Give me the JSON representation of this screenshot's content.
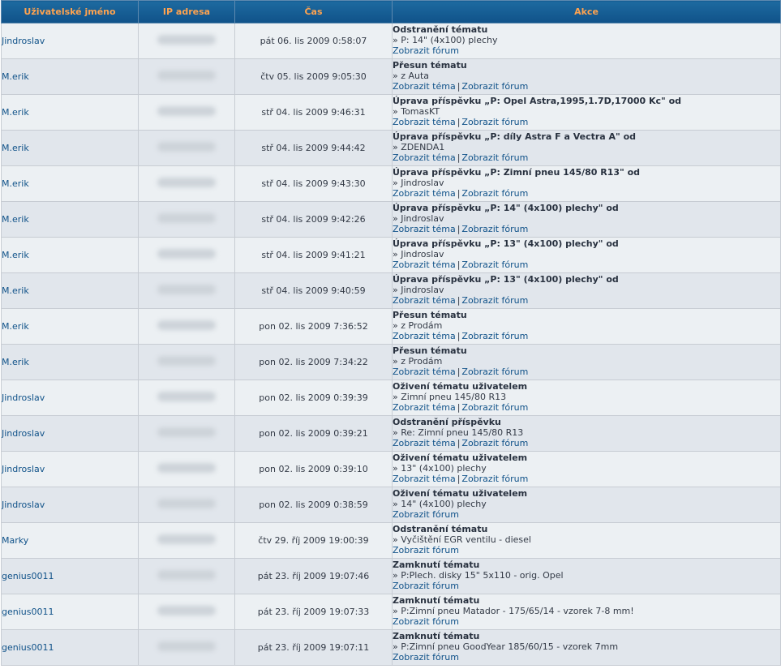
{
  "headers": {
    "user": "Uživatelské jméno",
    "ip": "IP adresa",
    "time": "Čas",
    "action": "Akce"
  },
  "links": {
    "topic": "Zobrazit téma",
    "forum": "Zobrazit fórum",
    "separator": "|"
  },
  "rows": [
    {
      "user": "Jindroslav",
      "time": "pát 06. lis 2009 0:58:07",
      "title": "Odstranění tématu",
      "detail": "» P: 14\" (4x100) plechy",
      "topic_link": false
    },
    {
      "user": "M.erik",
      "time": "čtv 05. lis 2009 9:05:30",
      "title": "Přesun tématu",
      "detail": "» z Auta",
      "topic_link": true
    },
    {
      "user": "M.erik",
      "time": "stř 04. lis 2009 9:46:31",
      "title": "Úprava příspěvku „P: Opel Astra,1995,1.7D,17000 Kc\" od",
      "detail": "» TomasKT",
      "topic_link": true
    },
    {
      "user": "M.erik",
      "time": "stř 04. lis 2009 9:44:42",
      "title": "Úprava příspěvku „P: díly Astra F a Vectra A\" od",
      "detail": "» ZDENDA1",
      "topic_link": true
    },
    {
      "user": "M.erik",
      "time": "stř 04. lis 2009 9:43:30",
      "title": "Úprava příspěvku „P: Zimní pneu 145/80 R13\" od",
      "detail": "» Jindroslav",
      "topic_link": true
    },
    {
      "user": "M.erik",
      "time": "stř 04. lis 2009 9:42:26",
      "title": "Úprava příspěvku „P: 14\" (4x100) plechy\" od",
      "detail": "» Jindroslav",
      "topic_link": true
    },
    {
      "user": "M.erik",
      "time": "stř 04. lis 2009 9:41:21",
      "title": "Úprava příspěvku „P: 13\" (4x100) plechy\" od",
      "detail": "» Jindroslav",
      "topic_link": true
    },
    {
      "user": "M.erik",
      "time": "stř 04. lis 2009 9:40:59",
      "title": "Úprava příspěvku „P: 13\" (4x100) plechy\" od",
      "detail": "» Jindroslav",
      "topic_link": true
    },
    {
      "user": "M.erik",
      "time": "pon 02. lis 2009 7:36:52",
      "title": "Přesun tématu",
      "detail": "» z Prodám",
      "topic_link": true
    },
    {
      "user": "M.erik",
      "time": "pon 02. lis 2009 7:34:22",
      "title": "Přesun tématu",
      "detail": "» z Prodám",
      "topic_link": true
    },
    {
      "user": "Jindroslav",
      "time": "pon 02. lis 2009 0:39:39",
      "title": "Oživení tématu uživatelem",
      "detail": "» Zimní pneu 145/80 R13",
      "topic_link": true
    },
    {
      "user": "Jindroslav",
      "time": "pon 02. lis 2009 0:39:21",
      "title": "Odstranění příspěvku",
      "detail": "» Re: Zimní pneu 145/80 R13",
      "topic_link": true
    },
    {
      "user": "Jindroslav",
      "time": "pon 02. lis 2009 0:39:10",
      "title": "Oživení tématu uživatelem",
      "detail": "» 13\" (4x100) plechy",
      "topic_link": true
    },
    {
      "user": "Jindroslav",
      "time": "pon 02. lis 2009 0:38:59",
      "title": "Oživení tématu uživatelem",
      "detail": "» 14\" (4x100) plechy",
      "topic_link": false
    },
    {
      "user": "Marky",
      "time": "čtv 29. říj 2009 19:00:39",
      "title": "Odstranění tématu",
      "detail": "» Vyčištění EGR ventilu - diesel",
      "topic_link": false
    },
    {
      "user": "genius0011",
      "time": "pát 23. říj 2009 19:07:46",
      "title": "Zamknutí tématu",
      "detail": "» P:Plech. disky 15\" 5x110 - orig. Opel",
      "topic_link": false
    },
    {
      "user": "genius0011",
      "time": "pát 23. říj 2009 19:07:33",
      "title": "Zamknutí tématu",
      "detail": "» P:Zimní pneu Matador - 175/65/14 - vzorek 7-8 mm!",
      "topic_link": false
    },
    {
      "user": "genius0011",
      "time": "pát 23. říj 2009 19:07:11",
      "title": "Zamknutí tématu",
      "detail": "» P:Zimní pneu GoodYear 185/60/15 - vzorek 7mm",
      "topic_link": false
    }
  ]
}
